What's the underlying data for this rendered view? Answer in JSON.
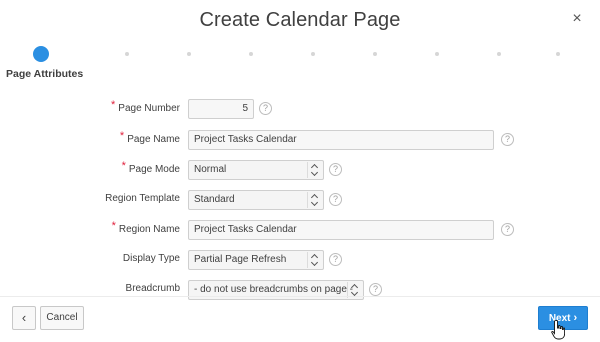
{
  "dialog": {
    "title": "Create Calendar Page",
    "close_glyph": "×"
  },
  "wizard": {
    "current_step_label": "Page Attributes",
    "step_count": 9,
    "active_step": 1,
    "active_color": "#2b8fe2",
    "inactive_color": "#d6d6d6"
  },
  "form": {
    "required_mark": "*",
    "help_glyph": "?",
    "page_number": {
      "label": "Page Number",
      "value": "5"
    },
    "page_name": {
      "label": "Page Name",
      "value": "Project Tasks Calendar"
    },
    "page_mode": {
      "label": "Page Mode",
      "value": "Normal"
    },
    "region_template": {
      "label": "Region Template",
      "value": "Standard"
    },
    "region_name": {
      "label": "Region Name",
      "value": "Project Tasks Calendar"
    },
    "display_type": {
      "label": "Display Type",
      "value": "Partial Page Refresh"
    },
    "breadcrumb": {
      "label": "Breadcrumb",
      "value": "- do not use breadcrumbs on page -"
    }
  },
  "footer": {
    "back_glyph": "‹",
    "cancel_label": "Cancel",
    "next_label": "Next",
    "next_glyph": "›",
    "next_color": "#2b8fe2"
  }
}
